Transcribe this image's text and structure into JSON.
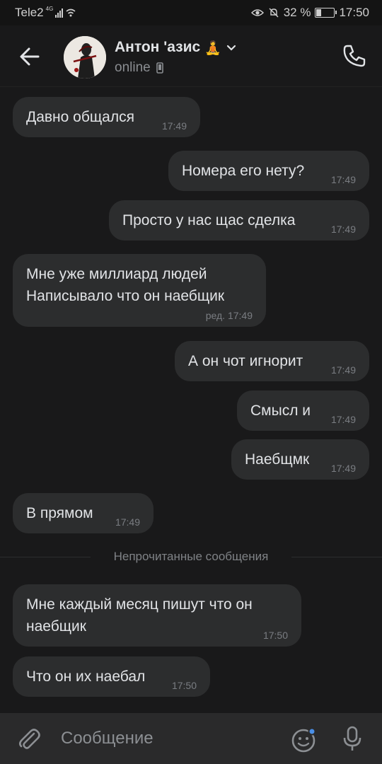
{
  "status_bar": {
    "carrier": "Tele2",
    "network": "4G",
    "battery": "32 %",
    "battery_level": 0.32,
    "time": "17:50"
  },
  "header": {
    "contact_name": "Антон 'азис",
    "contact_emoji": "🧘",
    "status": "online"
  },
  "messages": [
    {
      "text": "Давно общался",
      "time": "17:49",
      "side": "in"
    },
    {
      "text": "Номера его нету?",
      "time": "17:49",
      "side": "out"
    },
    {
      "text": "Просто у нас щас сделка",
      "time": "17:49",
      "side": "out"
    },
    {
      "text": "Мне уже миллиард людей\nНаписывало что он наебщик",
      "time": "ред. 17:49",
      "side": "in"
    },
    {
      "text": "А он чот игнорит",
      "time": "17:49",
      "side": "out"
    },
    {
      "text": "Смысл и",
      "time": "17:49",
      "side": "out"
    },
    {
      "text": "Наебщмк",
      "time": "17:49",
      "side": "out"
    },
    {
      "text": "В прямом",
      "time": "17:49",
      "side": "in"
    },
    {
      "text": "Мне каждый месяц пишут что он\nнаебщик",
      "time": "17:50",
      "side": "in"
    },
    {
      "text": "Что он их наебал",
      "time": "17:50",
      "side": "in"
    }
  ],
  "unread_divider": "Непрочитанные сообщения",
  "composer": {
    "placeholder": "Сообщение"
  },
  "colors": {
    "background": "#19191a",
    "bubble": "#2c2d2e",
    "accent": "#4a8fe7"
  }
}
